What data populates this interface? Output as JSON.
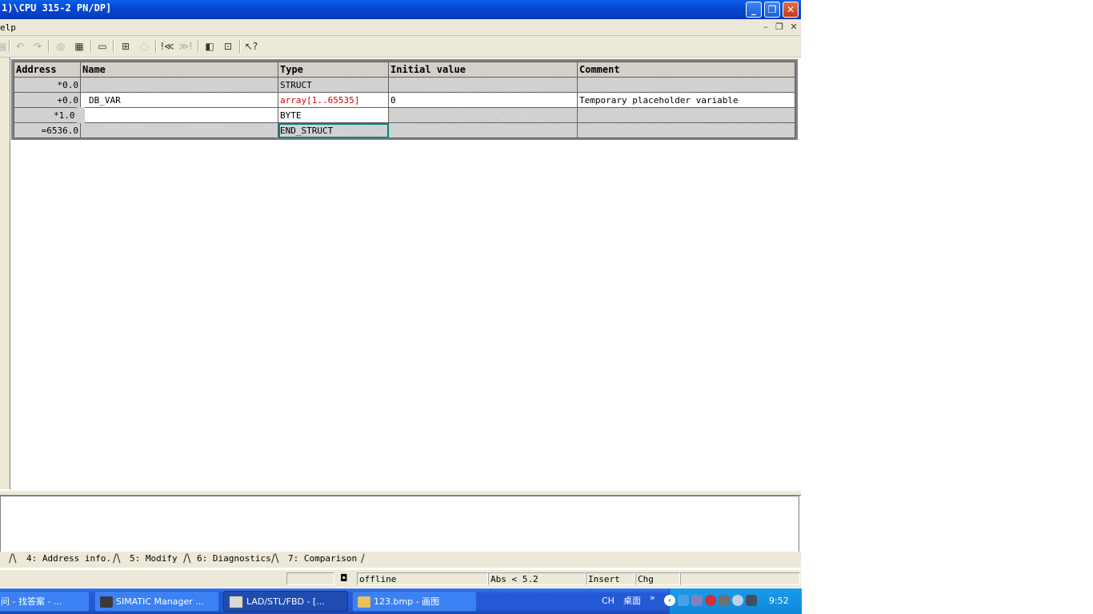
{
  "window": {
    "title": "1)\\CPU 315-2 PN/DP]"
  },
  "menubar": {
    "help_label": "elp"
  },
  "table": {
    "headers": [
      "Address",
      "Name",
      "Type",
      "Initial value",
      "Comment"
    ],
    "rows": [
      {
        "address": "*0.0",
        "name": "",
        "type": "STRUCT",
        "initial": "",
        "comment": ""
      },
      {
        "address": "+0.0",
        "name": "DB_VAR",
        "type": "array[1..65535]",
        "initial": "0",
        "comment": "Temporary placeholder variable"
      },
      {
        "address": "*1.0",
        "name": "",
        "type": "BYTE",
        "initial": "",
        "comment": ""
      },
      {
        "address": "=6536.0",
        "name": "",
        "type": "END_STRUCT",
        "initial": "",
        "comment": ""
      }
    ]
  },
  "tabs": [
    "4: Address info.",
    "5: Modify",
    "6: Diagnostics",
    "7: Comparison"
  ],
  "status": {
    "mode": "offline",
    "abs": "Abs < 5.2",
    "insert": "Insert",
    "chg": "Chg"
  },
  "taskbar": {
    "items": [
      "问 - 找答案 - ...",
      "SIMATIC Manager ...",
      "LAD/STL/FBD  - [...",
      "123.bmp - 画图"
    ],
    "lang": "CH",
    "desktop": "桌面",
    "clock": "9:52"
  },
  "colors": {
    "titlebar": "#0648d4",
    "accent_red": "#d40000",
    "selection": "#008080",
    "taskbar": "#2459d6",
    "tray": "#0f87d8"
  }
}
